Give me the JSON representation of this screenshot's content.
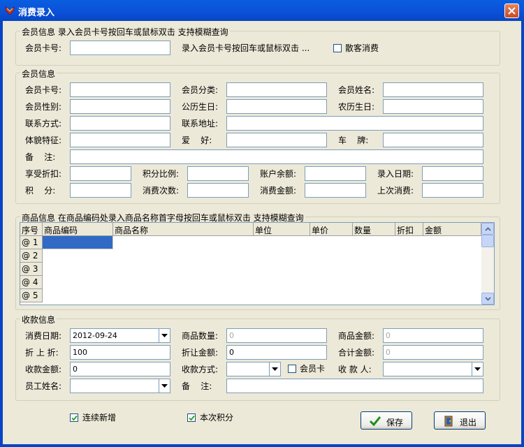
{
  "window": {
    "title": "消费录入"
  },
  "member_lookup": {
    "legend": "会员信息 录入会员卡号按回车或鼠标双击 支持模糊查询",
    "card_label": "会员卡号:",
    "card_value": "",
    "hint": "录入会员卡号按回车或鼠标双击 ...",
    "walkin_label": "散客消费",
    "walkin_checked": false
  },
  "member_info": {
    "legend": "会员信息",
    "card_label": "会员卡号:",
    "category_label": "会员分类:",
    "name_label": "会员姓名:",
    "gender_label": "会员性别:",
    "solar_birthday_label": "公历生日:",
    "lunar_birthday_label": "农历生日:",
    "contact_label": "联系方式:",
    "address_label": "联系地址:",
    "features_label": "体貌特征:",
    "hobby_label": "爱    好:",
    "plate_label": "车    牌:",
    "remark_label": "备    注:",
    "discount_label": "享受折扣:",
    "points_ratio_label": "积分比例:",
    "balance_label": "账户余额:",
    "entry_date_label": "录入日期:",
    "points_label": "积    分:",
    "visit_count_label": "消费次数:",
    "spend_amount_label": "消费金额:",
    "last_visit_label": "上次消费:"
  },
  "products": {
    "legend": "商品信息 在商品编码处录入商品名称首字母按回车或鼠标双击 支持模糊查询",
    "columns": [
      "序号",
      "商品编码",
      "商品名称",
      "单位",
      "单价",
      "数量",
      "折扣",
      "金额"
    ],
    "rows": [
      "@ 1",
      "@ 2",
      "@ 3",
      "@ 4",
      "@ 5"
    ]
  },
  "payment": {
    "legend": "收款信息",
    "date_label": "消费日期:",
    "date_value": "2012-09-24",
    "qty_label": "商品数量:",
    "qty_value": "0",
    "goods_amount_label": "商品金额:",
    "goods_amount_value": "0",
    "discount_label": "折 上 折:",
    "discount_value": "100",
    "discount_amount_label": "折让金额:",
    "discount_amount_value": "0",
    "total_label": "合计金额:",
    "total_value": "0",
    "received_label": "收款金额:",
    "received_value": "0",
    "method_label": "收款方式:",
    "method_value": "",
    "member_card_label": "会员卡",
    "member_card_checked": false,
    "receiver_label": "收 款 人:",
    "receiver_value": "",
    "staff_label": "员工姓名:",
    "staff_value": "",
    "remark_label": "备    注:",
    "remark_value": ""
  },
  "footer": {
    "continuous_label": "连续新增",
    "continuous_checked": true,
    "points_label": "本次积分",
    "points_checked": true,
    "save_label": "保存",
    "exit_label": "退出"
  },
  "colors": {
    "titlebar": "#0a54d8",
    "dialog_bg": "#ece9d8",
    "input_border": "#7f9db9",
    "selected_cell": "#316ac5"
  }
}
